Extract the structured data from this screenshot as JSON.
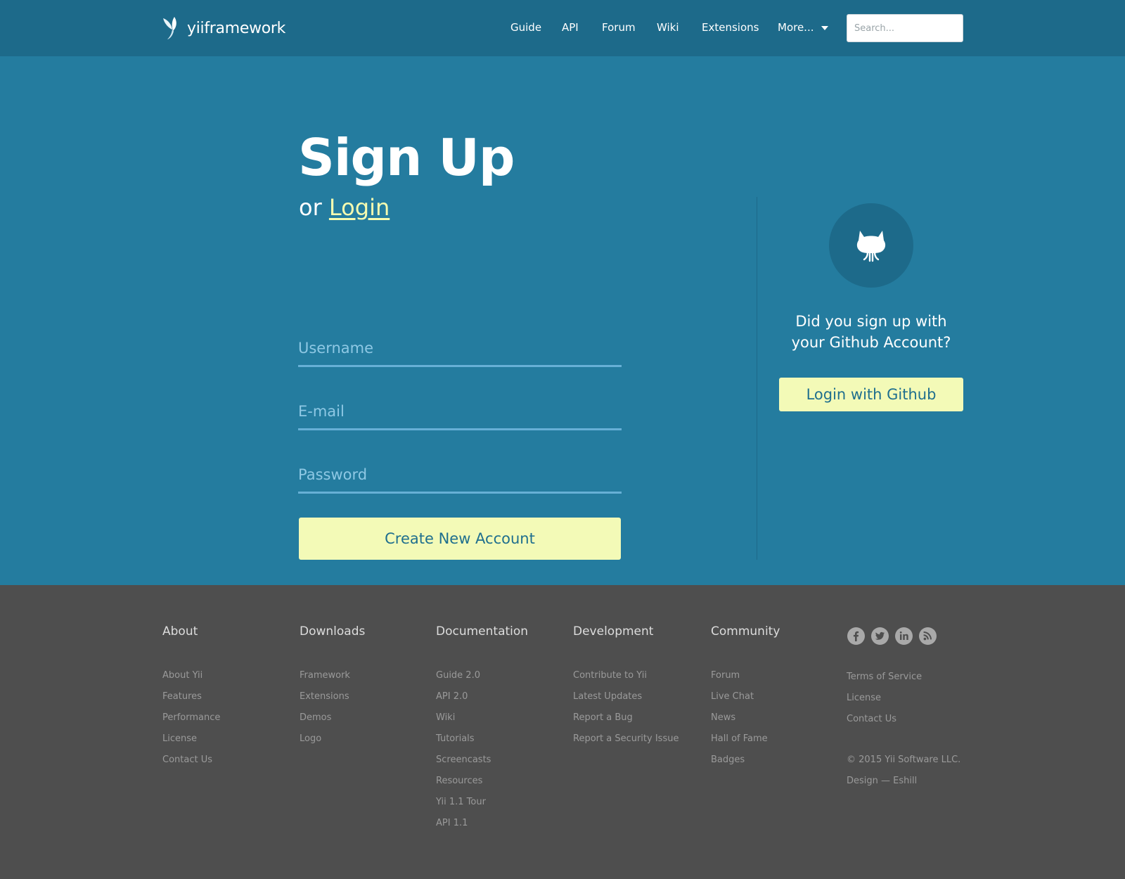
{
  "header": {
    "logo_text": "yiiframework",
    "nav": [
      {
        "label": "Guide"
      },
      {
        "label": "API"
      },
      {
        "label": "Forum"
      },
      {
        "label": "Wiki"
      },
      {
        "label": "Extensions"
      },
      {
        "label": "More..."
      }
    ],
    "search_placeholder": "Search..."
  },
  "signup": {
    "title": "Sign Up",
    "or_text": "or",
    "login_link": "Login",
    "username_placeholder": "Username",
    "email_placeholder": "E-mail",
    "password_placeholder": "Password",
    "create_button": "Create New Account"
  },
  "github": {
    "question": "Did you sign up with your Github Account?",
    "button": "Login with Github"
  },
  "footer": {
    "columns": [
      {
        "heading": "About",
        "items": [
          "About Yii",
          "Features",
          "Performance",
          "License",
          "Contact Us"
        ]
      },
      {
        "heading": "Downloads",
        "items": [
          "Framework",
          "Extensions",
          "Demos",
          "Logo"
        ]
      },
      {
        "heading": "Documentation",
        "items": [
          "Guide 2.0",
          "API 2.0",
          "Wiki",
          "Tutorials",
          "Screencasts",
          "Resources",
          "Yii 1.1 Tour",
          "API 1.1"
        ]
      },
      {
        "heading": "Development",
        "items": [
          "Contribute to Yii",
          "Latest Updates",
          "Report a Bug",
          "Report a Security Issue"
        ]
      },
      {
        "heading": "Community",
        "items": [
          "Forum",
          "Live Chat",
          "News",
          "Hall of Fame",
          "Badges"
        ]
      }
    ],
    "meta_links": [
      "Terms of Service",
      "License",
      "Contact Us"
    ],
    "copyright": "© 2015 Yii Software LLC.",
    "design_credit": "Design — Eshill",
    "social_icons": [
      "facebook-icon",
      "twitter-icon",
      "linkedin-icon",
      "rss-icon"
    ]
  },
  "colors": {
    "header_bg": "#1d6a8a",
    "hero_bg": "#247c9f",
    "button_bg": "#f3fab7",
    "footer_bg": "#4e4e4e"
  }
}
